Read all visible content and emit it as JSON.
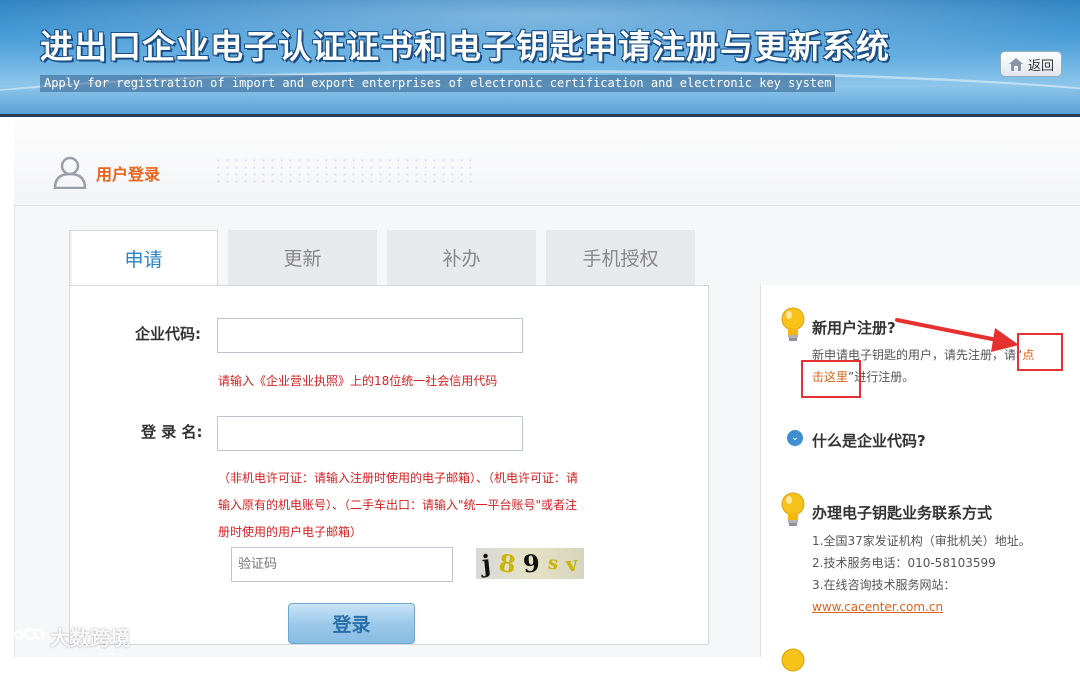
{
  "header": {
    "title": "进出口企业电子认证证书和电子钥匙申请注册与更新系统",
    "subtitle": "Apply for registration of import and export enterprises of electronic certification and electronic key system",
    "back_label": "返回"
  },
  "login": {
    "title": "用户登录"
  },
  "tabs": [
    {
      "label": "申请",
      "active": true
    },
    {
      "label": "更新",
      "active": false
    },
    {
      "label": "补办",
      "active": false
    },
    {
      "label": "手机授权",
      "active": false
    }
  ],
  "form": {
    "company_code_label": "企业代码:",
    "company_code_value": "",
    "company_code_hint": "请输入《企业营业执照》上的18位统一社会信用代码",
    "login_name_label": "登 录 名:",
    "login_name_value": "",
    "login_name_hint_1": "（非机电许可证：请输入注册时使用的电子邮箱）、（机电许可证：请",
    "login_name_hint_2": "输入原有的机电账号）、（二手车出口：请输入\"统一平台账号\"或者注",
    "login_name_hint_3": "册时使用的用户电子邮箱）",
    "captcha_placeholder": "验证码",
    "captcha_chars": [
      "j",
      "8",
      "9",
      "s",
      "v"
    ],
    "captcha_colors": [
      "#111111",
      "#c9b400",
      "#111111",
      "#c9b400",
      "#c9b400"
    ],
    "login_button": "登录"
  },
  "sidebar": {
    "new_user_title": "新用户注册?",
    "new_user_text_before": "新申请电子钥匙的用户，请先注册，请“",
    "new_user_link_1": "点",
    "new_user_link_2": "击这里",
    "new_user_text_after": "”进行注册。",
    "company_code_title": "什么是企业代码?",
    "contact_title": "办理电子钥匙业务联系方式",
    "contact_items": [
      "1.全国37家发证机构（审批机关）地址。",
      "2.技术服务电话：010-58103599",
      "3.在线咨询技术服务网站："
    ],
    "contact_link": "www.cacenter.com.cn"
  },
  "watermark": {
    "text": "大数跨境"
  },
  "colors": {
    "accent_orange": "#e8641c",
    "hint_red": "#d42020",
    "tab_active_blue": "#2a82c8",
    "annotation_red": "#e5312f"
  }
}
